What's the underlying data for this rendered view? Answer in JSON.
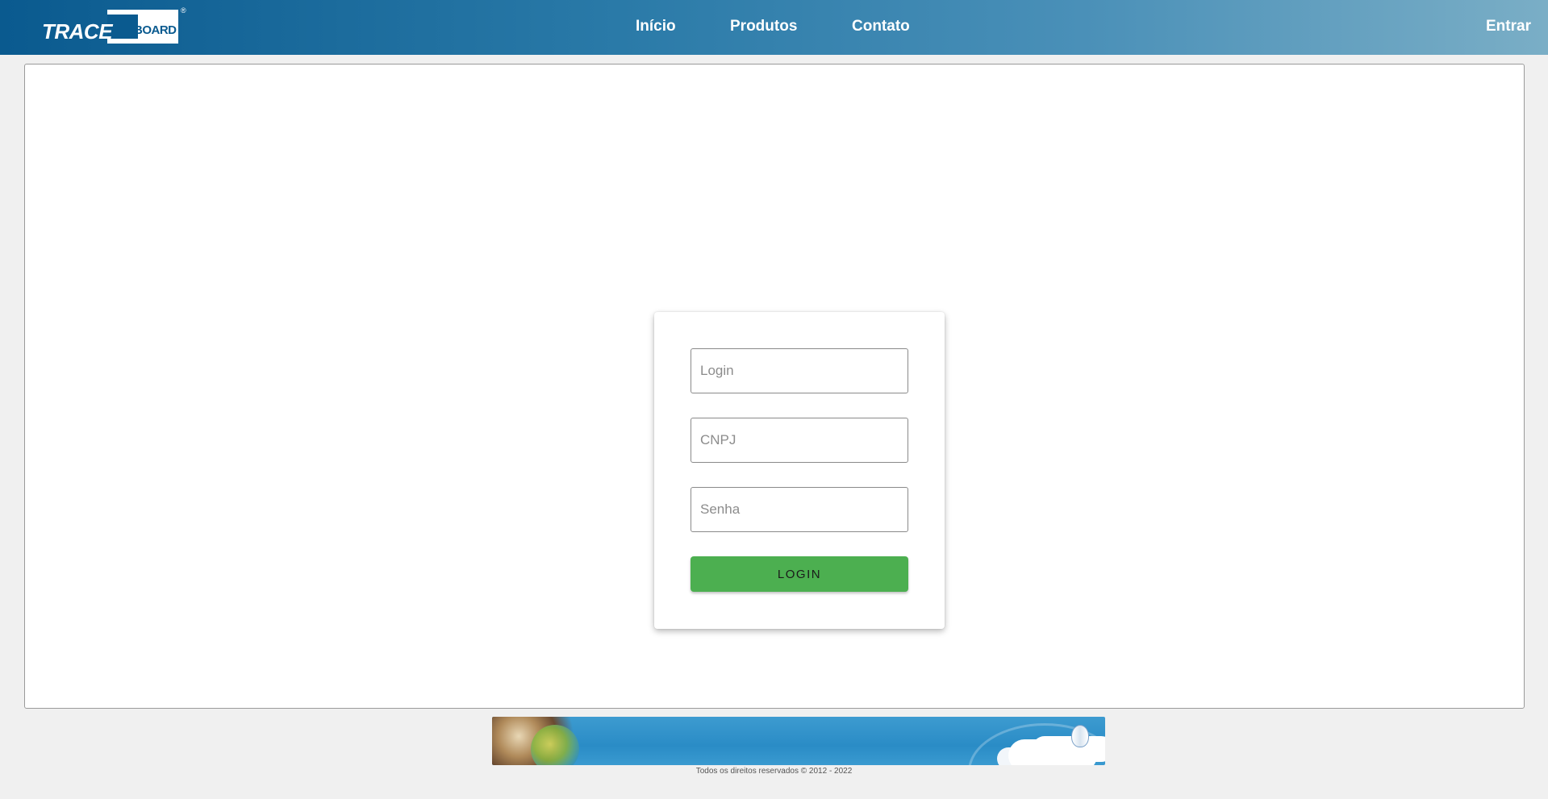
{
  "header": {
    "logo": {
      "part1": "TRACE",
      "part2": "BOARD",
      "reg": "®"
    },
    "nav": {
      "inicio": "Início",
      "produtos": "Produtos",
      "contato": "Contato",
      "entrar": "Entrar"
    }
  },
  "login_form": {
    "login_placeholder": "Login",
    "cnpj_placeholder": "CNPJ",
    "senha_placeholder": "Senha",
    "button_label": "LOGIN"
  },
  "footer": {
    "copyright": "Todos os direitos reservados © 2012 - 2022"
  },
  "colors": {
    "header_gradient_start": "#0a5a8f",
    "header_gradient_end": "#7aaec6",
    "login_button": "#4caf50",
    "background": "#f0f0f0"
  }
}
